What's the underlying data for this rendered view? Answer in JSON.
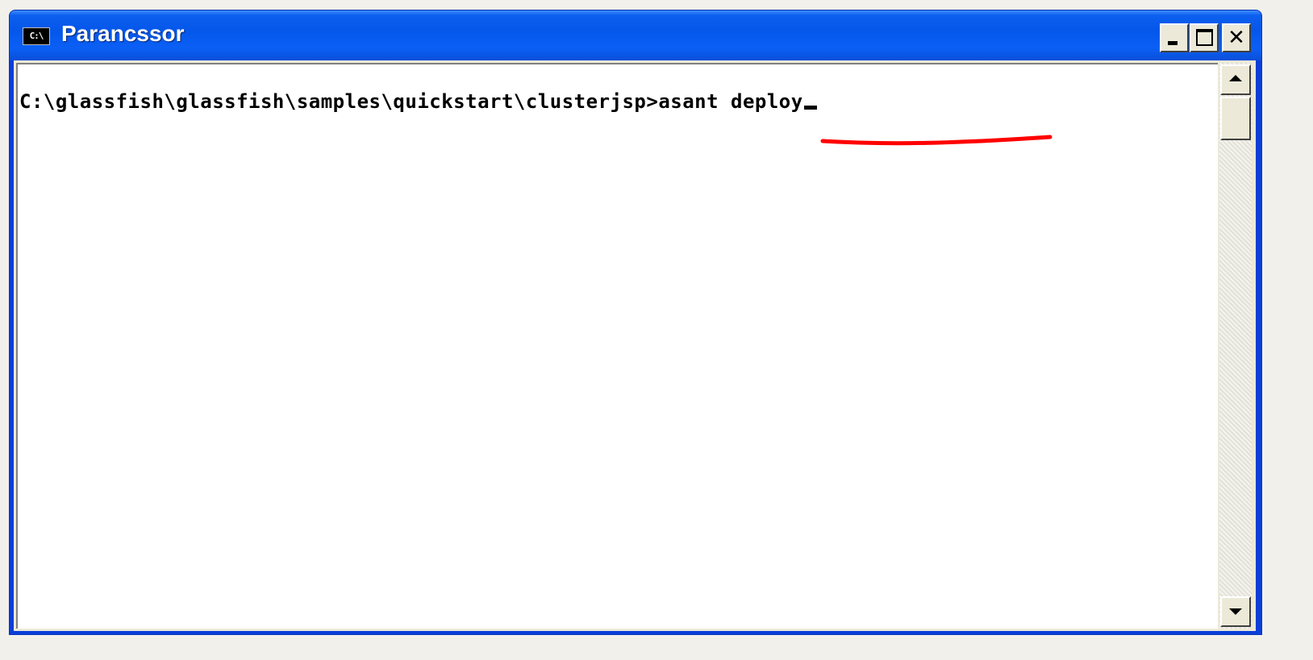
{
  "window": {
    "title": "Parancssor",
    "icon": "cmd-icon",
    "icon_text": "C:\\",
    "controls": {
      "minimize": "minimize-icon",
      "maximize": "maximize-icon",
      "close": "close-icon",
      "close_glyph": "✕"
    }
  },
  "console": {
    "prompt": "C:\\glassfish\\glassfish\\samples\\quickstart\\clusterjsp>",
    "command": "asant deploy",
    "annotation_color": "#ff0000"
  },
  "scrollbar": {
    "up_icon": "arrow-up-icon",
    "down_icon": "arrow-down-icon"
  },
  "colors": {
    "titlebar": "#0557ea",
    "console_bg": "#ffffff",
    "console_text": "#000000",
    "chrome": "#ece9d8"
  }
}
